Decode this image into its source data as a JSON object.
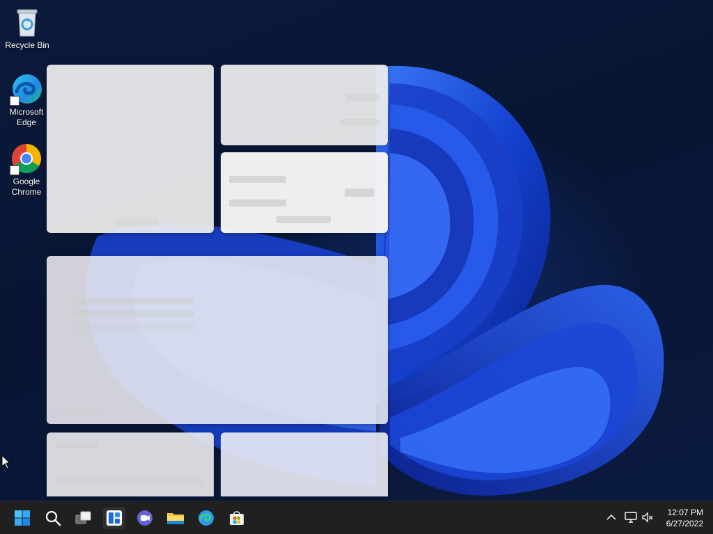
{
  "desktop": {
    "icons": [
      {
        "label": "Recycle Bin",
        "icon": "recycle-bin-icon"
      },
      {
        "label": "Microsoft Edge",
        "icon": "edge-icon"
      },
      {
        "label": "Google Chrome",
        "icon": "chrome-icon"
      }
    ]
  },
  "widgets": {
    "state": "loading",
    "cards": [
      "large-top-left",
      "small-top-right",
      "small-mid-right",
      "wide-middle",
      "bottom-left",
      "bottom-right"
    ]
  },
  "taskbar": {
    "apps": [
      {
        "name": "start",
        "icon": "windows-start-icon"
      },
      {
        "name": "search",
        "icon": "search-icon"
      },
      {
        "name": "task-view",
        "icon": "task-view-icon"
      },
      {
        "name": "widgets",
        "icon": "widgets-icon"
      },
      {
        "name": "teams-chat",
        "icon": "chat-icon"
      },
      {
        "name": "file-explorer",
        "icon": "folder-icon"
      },
      {
        "name": "edge",
        "icon": "edge-icon"
      },
      {
        "name": "store",
        "icon": "store-icon"
      }
    ],
    "tray": {
      "icons": [
        "chevron-up-icon",
        "network-icon",
        "volume-muted-icon"
      ],
      "time": "12:07 PM",
      "date": "6/27/2022"
    }
  },
  "colors": {
    "accent": "#1f5fe0",
    "taskbar": "#202020",
    "widget_card": "#eeeeee"
  }
}
